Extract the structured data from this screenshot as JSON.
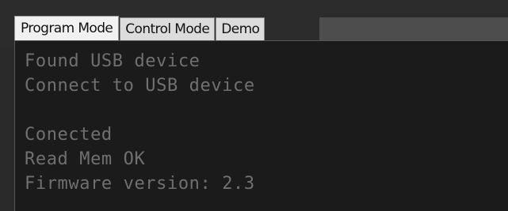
{
  "tabs": [
    {
      "label": "Program Mode",
      "active": true
    },
    {
      "label": "Control Mode",
      "active": false
    },
    {
      "label": "Demo",
      "active": false
    }
  ],
  "console": {
    "lines": [
      "Found USB device",
      "Connect to USB device",
      "",
      "Conected",
      "Read Mem OK",
      "Firmware version: 2.3"
    ]
  },
  "colors": {
    "window_bg": "#2a2a2a",
    "console_bg": "#1b1b1b",
    "console_text": "#707070",
    "active_tab_bg": "#f1f1f1",
    "inactive_tab_bg": "#dcdcdc"
  }
}
